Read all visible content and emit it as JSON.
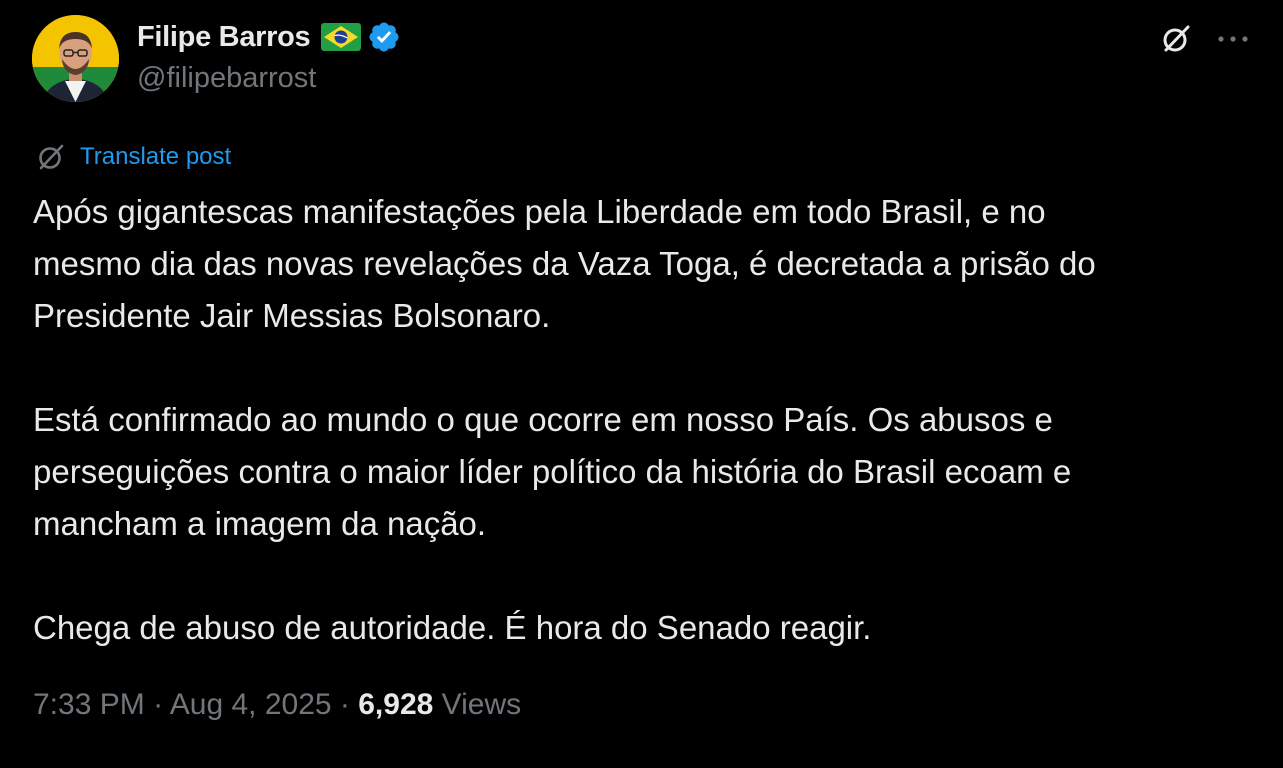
{
  "author": {
    "display_name": "Filipe Barros",
    "handle": "@filipebarrost",
    "flag_emoji": "brazil-flag-icon",
    "verified_icon": "verified-badge-icon",
    "verified_color": "#1d9bf0"
  },
  "actions": {
    "grok_icon": "grok-icon",
    "more_icon": "more-options-icon"
  },
  "translate": {
    "label": "Translate post",
    "icon": "grok-icon",
    "color": "#1d9bf0"
  },
  "tweet": {
    "paragraphs": [
      "Após gigantescas manifestações pela Liberdade em todo Brasil, e no\nmesmo dia das novas revelações da Vaza Toga, é decretada a prisão do\nPresidente Jair Messias Bolsonaro.",
      "Está confirmado ao mundo o que ocorre em nosso País. Os abusos e\nperseguições contra o maior líder político da história do Brasil ecoam e\nmancham a imagem da nação.",
      "Chega de abuso de autoridade. É hora do Senado reagir."
    ]
  },
  "meta": {
    "time": "7:33 PM",
    "separator": " · ",
    "date": "Aug 4, 2025",
    "views_count": "6,928",
    "views_label": " Views"
  }
}
